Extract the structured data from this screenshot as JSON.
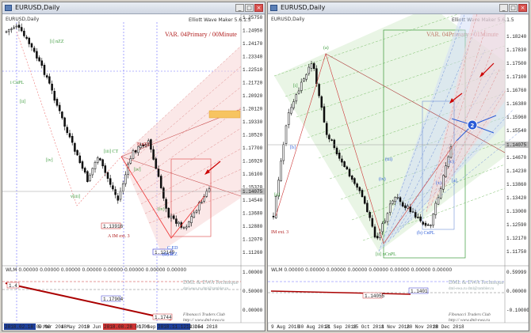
{
  "left": {
    "window_title": "EURUSD,Daily",
    "chart_title": "EURUSD,Daily",
    "indicator": "Elliott Wave Maker 5.6.1.5",
    "var_label": "VAR. 04Primary / 00Minute",
    "prices": [
      "1.25750",
      "1.24950",
      "1.24170",
      "1.23340",
      "1.22510",
      "1.21720",
      "1.20920",
      "1.20120",
      "1.19330",
      "1.18520",
      "1.17700",
      "1.16920",
      "1.16100",
      "1.15320",
      "1.14540",
      "1.13680",
      "1.12880",
      "1.12070",
      "1.11260"
    ],
    "current_price": "1.14075",
    "wave_labels": {
      "b_top": "B nZZ",
      "a_im": "A IM ext. 3",
      "c_ed": "C ED",
      "b_izz": "(B) IZZ",
      "iv_left": "(iv)",
      "iv_mid": "[iv]",
      "iii_ct": "[iii] CT",
      "iv_small": "[iv]",
      "ii": "[ii]",
      "v_left": "v[iii]",
      "i_cnpl": "i CnPL",
      "zz_top": "[i] nZZ"
    },
    "price_boxes": [
      "1.13916",
      "1.12149"
    ],
    "indicator_box": "1.17904",
    "osc_header": "WLM 0.00000 0.00000 0.00000 0.00000 0.00000 0.00000 0.00000 0.00000",
    "osc_values": [
      "1.00000",
      "0.50000",
      "0.00000"
    ],
    "osc_box_left": "1.4",
    "osc_box_right": "1.1744",
    "watermark_title": "DML & EWA Technique",
    "watermark_sub": "dml-ewa.ru   dml@rambler.ru",
    "brand1": "Fibonacci   Traders   Club",
    "brand2": "http://  www.dml-ewa.ru",
    "brand3": "http://  redtrader.ru",
    "dates": [
      "5 Mar 2018",
      "4 May 2018",
      "19 Jun 2018",
      "2018.08.28 00:00",
      "17 Sep 2018",
      "2018.11.12 23:54",
      "14 Dec 2018"
    ],
    "date_badge_left": "2018.02.18 00:00"
  },
  "right": {
    "window_title": "EURUSD,Daily",
    "chart_title": "EURUSD,Daily",
    "indicator": "Elliott Wave Maker 5.6.1.5",
    "var_label": "VAR. 04Primary / 01Minute",
    "prices": [
      "1.18240",
      "1.17830",
      "1.17500",
      "1.17100",
      "1.16760",
      "1.16380",
      "1.15960",
      "1.15540",
      "1.15130",
      "1.14670",
      "1.14230",
      "1.13860",
      "1.13420",
      "1.13000",
      "1.12590",
      "1.12170",
      "1.11750"
    ],
    "current_price": "1.14075",
    "im_label": "IM ext. 3",
    "wave_labels": {
      "ii_cnpl": "[ii] nCnPL",
      "b_cnpl": "(b) CnPL",
      "c_top": "(c)",
      "a_top": "(a)",
      "iv": "(iv)",
      "iii": "(iii)",
      "ii": "[ii]",
      "i": "[i]",
      "b": "[b]",
      "x": "(x)",
      "a": "[a]"
    },
    "circle_label": "2",
    "osc_header": "WLM 0.00000 0.00000 0.00000 0.00000 0.00000 0.00000 0.00000 0.00000",
    "osc_box": "1.14055",
    "osc_box2": "1.1401",
    "osc_values": [
      "0.59999",
      "0.00000",
      "-0.10000"
    ],
    "watermark_title": "DML & EWA Technique",
    "watermark_sub": "dml-ewa.ru   dml@rambler.ru",
    "brand1": "Fibonacci   Traders   Club",
    "brand2": "http://  www.dml-ewa.ru",
    "brand3": "http://  redtrader.ru",
    "dates": [
      "9 Aug 2018",
      "30 Aug 2018",
      "21 Sep 2018",
      "15 Oct 2018",
      "1 Nov 2018",
      "20 Nov 2018",
      "28 Dec 2018"
    ]
  },
  "colors": {
    "bull": "#ffffff",
    "bear": "#000000",
    "accent_red": "#b22222",
    "accent_blue": "#2a5bd7",
    "green": "#3a9a3a"
  }
}
